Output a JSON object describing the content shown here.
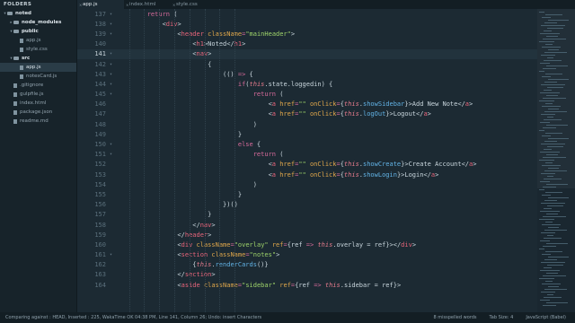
{
  "sidebar": {
    "header": "FOLDERS",
    "items": [
      {
        "label": "noted",
        "kind": "folder",
        "depth": 0,
        "open": true
      },
      {
        "label": "node_modules",
        "kind": "folder",
        "depth": 1,
        "open": false
      },
      {
        "label": "public",
        "kind": "folder",
        "depth": 1,
        "open": true
      },
      {
        "label": "app.js",
        "kind": "file",
        "depth": 2
      },
      {
        "label": "style.css",
        "kind": "file",
        "depth": 2
      },
      {
        "label": "src",
        "kind": "folder",
        "depth": 1,
        "open": true
      },
      {
        "label": "app.js",
        "kind": "file",
        "depth": 2,
        "selected": true
      },
      {
        "label": "notesCard.js",
        "kind": "file",
        "depth": 2
      },
      {
        "label": ".gitignore",
        "kind": "file",
        "depth": 1
      },
      {
        "label": "gulpfile.js",
        "kind": "file",
        "depth": 1
      },
      {
        "label": "index.html",
        "kind": "file",
        "depth": 1
      },
      {
        "label": "package.json",
        "kind": "file",
        "depth": 1
      },
      {
        "label": "readme.md",
        "kind": "file",
        "depth": 1
      }
    ]
  },
  "tabs": [
    {
      "label": "app.js",
      "active": true
    },
    {
      "label": "index.html",
      "active": false
    },
    {
      "label": "style.css",
      "active": false
    }
  ],
  "editor": {
    "current_line": 141,
    "lines": [
      {
        "n": "137",
        "fold": "▾",
        "tokens": [
          [
            "plain",
            "        "
          ],
          [
            "kw",
            "return"
          ],
          [
            "plain",
            " ("
          ]
        ]
      },
      {
        "n": "138",
        "fold": "▾",
        "tokens": [
          [
            "plain",
            "            <"
          ],
          [
            "tag",
            "div"
          ],
          [
            "plain",
            ">"
          ]
        ]
      },
      {
        "n": "139",
        "fold": "▾",
        "tokens": [
          [
            "plain",
            "                <"
          ],
          [
            "tag",
            "header"
          ],
          [
            "plain",
            " "
          ],
          [
            "attr",
            "className"
          ],
          [
            "op",
            "="
          ],
          [
            "str",
            "\"mainHeader\""
          ],
          [
            "plain",
            ">"
          ]
        ]
      },
      {
        "n": "140",
        "fold": "",
        "tokens": [
          [
            "plain",
            "                    <"
          ],
          [
            "tag",
            "h1"
          ],
          [
            "plain",
            ">Noted</"
          ],
          [
            "tag",
            "h1"
          ],
          [
            "plain",
            ">"
          ]
        ]
      },
      {
        "n": "141",
        "fold": "▾",
        "tokens": [
          [
            "plain",
            "                    <"
          ],
          [
            "tag",
            "nav"
          ],
          [
            "plain",
            ">"
          ]
        ]
      },
      {
        "n": "142",
        "fold": "▾",
        "tokens": [
          [
            "plain",
            "                        {"
          ]
        ]
      },
      {
        "n": "143",
        "fold": "▾",
        "tokens": [
          [
            "plain",
            "                            (() "
          ],
          [
            "op",
            "=>"
          ],
          [
            "plain",
            " {"
          ]
        ]
      },
      {
        "n": "144",
        "fold": "▾",
        "tokens": [
          [
            "plain",
            "                                "
          ],
          [
            "kw",
            "if"
          ],
          [
            "plain",
            "("
          ],
          [
            "this",
            "this"
          ],
          [
            "plain",
            ".state.loggedin) {"
          ]
        ]
      },
      {
        "n": "145",
        "fold": "▾",
        "tokens": [
          [
            "plain",
            "                                    "
          ],
          [
            "kw",
            "return"
          ],
          [
            "plain",
            " ("
          ]
        ]
      },
      {
        "n": "146",
        "fold": "",
        "tokens": [
          [
            "plain",
            "                                        <"
          ],
          [
            "tag",
            "a"
          ],
          [
            "plain",
            " "
          ],
          [
            "attr",
            "href"
          ],
          [
            "op",
            "="
          ],
          [
            "str",
            "\"\""
          ],
          [
            "plain",
            " "
          ],
          [
            "attr",
            "onClick"
          ],
          [
            "op",
            "="
          ],
          [
            "plain",
            "{"
          ],
          [
            "this",
            "this"
          ],
          [
            "plain",
            "."
          ],
          [
            "fn",
            "showSidebar"
          ],
          [
            "plain",
            "}>Add New Note</"
          ],
          [
            "tag",
            "a"
          ],
          [
            "plain",
            ">"
          ]
        ]
      },
      {
        "n": "147",
        "fold": "",
        "tokens": [
          [
            "plain",
            "                                        <"
          ],
          [
            "tag",
            "a"
          ],
          [
            "plain",
            " "
          ],
          [
            "attr",
            "href"
          ],
          [
            "op",
            "="
          ],
          [
            "str",
            "\"\""
          ],
          [
            "plain",
            " "
          ],
          [
            "attr",
            "onClick"
          ],
          [
            "op",
            "="
          ],
          [
            "plain",
            "{"
          ],
          [
            "this",
            "this"
          ],
          [
            "plain",
            "."
          ],
          [
            "fn",
            "logOut"
          ],
          [
            "plain",
            "}>Logout</"
          ],
          [
            "tag",
            "a"
          ],
          [
            "plain",
            ">"
          ]
        ]
      },
      {
        "n": "148",
        "fold": "",
        "tokens": [
          [
            "plain",
            "                                    )"
          ]
        ]
      },
      {
        "n": "149",
        "fold": "",
        "tokens": [
          [
            "plain",
            "                                }"
          ]
        ]
      },
      {
        "n": "150",
        "fold": "▾",
        "tokens": [
          [
            "plain",
            "                                "
          ],
          [
            "kw",
            "else"
          ],
          [
            "plain",
            " {"
          ]
        ]
      },
      {
        "n": "151",
        "fold": "▾",
        "tokens": [
          [
            "plain",
            "                                    "
          ],
          [
            "kw",
            "return"
          ],
          [
            "plain",
            " ("
          ]
        ]
      },
      {
        "n": "152",
        "fold": "",
        "tokens": [
          [
            "plain",
            "                                        <"
          ],
          [
            "tag",
            "a"
          ],
          [
            "plain",
            " "
          ],
          [
            "attr",
            "href"
          ],
          [
            "op",
            "="
          ],
          [
            "str",
            "\"\""
          ],
          [
            "plain",
            " "
          ],
          [
            "attr",
            "onClick"
          ],
          [
            "op",
            "="
          ],
          [
            "plain",
            "{"
          ],
          [
            "this",
            "this"
          ],
          [
            "plain",
            "."
          ],
          [
            "fn",
            "showCreate"
          ],
          [
            "plain",
            "}>Create Account</"
          ],
          [
            "tag",
            "a"
          ],
          [
            "plain",
            ">"
          ]
        ]
      },
      {
        "n": "153",
        "fold": "",
        "tokens": [
          [
            "plain",
            "                                        <"
          ],
          [
            "tag",
            "a"
          ],
          [
            "plain",
            " "
          ],
          [
            "attr",
            "href"
          ],
          [
            "op",
            "="
          ],
          [
            "str",
            "\"\""
          ],
          [
            "plain",
            " "
          ],
          [
            "attr",
            "onClick"
          ],
          [
            "op",
            "="
          ],
          [
            "plain",
            "{"
          ],
          [
            "this",
            "this"
          ],
          [
            "plain",
            "."
          ],
          [
            "fn",
            "showLogin"
          ],
          [
            "plain",
            "}>Login</"
          ],
          [
            "tag",
            "a"
          ],
          [
            "plain",
            ">"
          ]
        ]
      },
      {
        "n": "154",
        "fold": "",
        "tokens": [
          [
            "plain",
            "                                    )"
          ]
        ]
      },
      {
        "n": "155",
        "fold": "",
        "tokens": [
          [
            "plain",
            "                                }"
          ]
        ]
      },
      {
        "n": "156",
        "fold": "",
        "tokens": [
          [
            "plain",
            "                            })()"
          ]
        ]
      },
      {
        "n": "157",
        "fold": "",
        "tokens": [
          [
            "plain",
            "                        }"
          ]
        ]
      },
      {
        "n": "158",
        "fold": "",
        "tokens": [
          [
            "plain",
            "                    </"
          ],
          [
            "tag",
            "nav"
          ],
          [
            "plain",
            ">"
          ]
        ]
      },
      {
        "n": "159",
        "fold": "",
        "tokens": [
          [
            "plain",
            "                </"
          ],
          [
            "tag",
            "header"
          ],
          [
            "plain",
            ">"
          ]
        ]
      },
      {
        "n": "160",
        "fold": "",
        "tokens": [
          [
            "plain",
            "                <"
          ],
          [
            "tag",
            "div"
          ],
          [
            "plain",
            " "
          ],
          [
            "attr",
            "className"
          ],
          [
            "op",
            "="
          ],
          [
            "str",
            "\"overlay\""
          ],
          [
            "plain",
            " "
          ],
          [
            "attr",
            "ref"
          ],
          [
            "op",
            "="
          ],
          [
            "plain",
            "{ref "
          ],
          [
            "op",
            "=>"
          ],
          [
            "plain",
            " "
          ],
          [
            "this",
            "this"
          ],
          [
            "plain",
            ".overlay = ref}></"
          ],
          [
            "tag",
            "div"
          ],
          [
            "plain",
            ">"
          ]
        ]
      },
      {
        "n": "161",
        "fold": "▾",
        "tokens": [
          [
            "plain",
            "                <"
          ],
          [
            "tag",
            "section"
          ],
          [
            "plain",
            " "
          ],
          [
            "attr",
            "className"
          ],
          [
            "op",
            "="
          ],
          [
            "str",
            "\"notes\""
          ],
          [
            "plain",
            ">"
          ]
        ]
      },
      {
        "n": "162",
        "fold": "",
        "tokens": [
          [
            "plain",
            "                    {"
          ],
          [
            "this",
            "this"
          ],
          [
            "plain",
            "."
          ],
          [
            "fn",
            "renderCards"
          ],
          [
            "plain",
            "()}"
          ]
        ]
      },
      {
        "n": "163",
        "fold": "",
        "tokens": [
          [
            "plain",
            "                </"
          ],
          [
            "tag",
            "section"
          ],
          [
            "plain",
            ">"
          ]
        ]
      },
      {
        "n": "164",
        "fold": "",
        "tokens": [
          [
            "plain",
            "                <"
          ],
          [
            "tag",
            "aside"
          ],
          [
            "plain",
            " "
          ],
          [
            "attr",
            "className"
          ],
          [
            "op",
            "="
          ],
          [
            "str",
            "\"sidebar\""
          ],
          [
            "plain",
            " "
          ],
          [
            "attr",
            "ref"
          ],
          [
            "op",
            "="
          ],
          [
            "plain",
            "{ref "
          ],
          [
            "op",
            "=>"
          ],
          [
            "plain",
            " "
          ],
          [
            "this",
            "this"
          ],
          [
            "plain",
            ".sidebar = ref}>"
          ]
        ]
      }
    ]
  },
  "status": {
    "left": "Comparing against : HEAD, Inserted : 225, WakaTime OK 04:38 PM, Line 141, Column 26; Undo: insert Characters",
    "misspelled": "8 misspelled words",
    "tab_size": "Tab Size: 4",
    "syntax": "JavaScript (Babel)"
  },
  "colors": {
    "background": "#1c2a33",
    "keyword": "#d66a9a",
    "tag": "#e8657b",
    "attribute": "#e0a74b",
    "string": "#9ed36a",
    "function": "#62b3e6"
  }
}
